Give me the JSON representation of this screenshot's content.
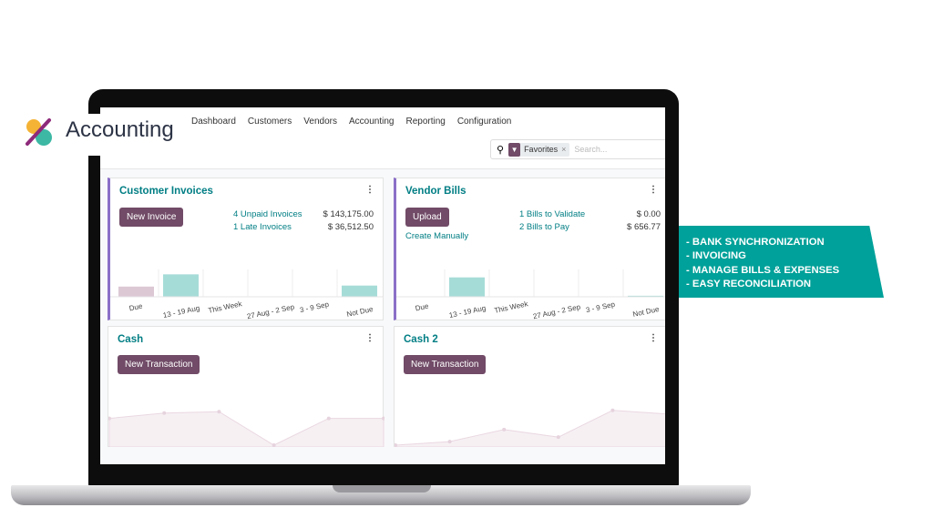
{
  "logo": {
    "title": "Accounting"
  },
  "menu": [
    "Dashboard",
    "Customers",
    "Vendors",
    "Accounting",
    "Reporting",
    "Configuration"
  ],
  "search": {
    "facet": "Favorites",
    "placeholder": "Search..."
  },
  "customer_invoices": {
    "title": "Customer Invoices",
    "button": "New Invoice",
    "links": [
      {
        "label": "4 Unpaid Invoices",
        "amount": "$ 143,175.00"
      },
      {
        "label": "1 Late Invoices",
        "amount": "$ 36,512.50"
      }
    ],
    "graph": {
      "categories": [
        "Due",
        "13 - 19 Aug",
        "This Week",
        "27 Aug - 2 Sep",
        "3 - 9 Sep",
        "Not Due"
      ],
      "values": [
        10,
        22,
        0,
        0,
        0,
        11
      ]
    }
  },
  "vendor_bills": {
    "title": "Vendor Bills",
    "button": "Upload",
    "create": "Create Manually",
    "links": [
      {
        "label": "1 Bills to Validate",
        "amount": "$ 0.00"
      },
      {
        "label": "2 Bills to Pay",
        "amount": "$ 656.77"
      }
    ],
    "graph": {
      "categories": [
        "Due",
        "13 - 19 Aug",
        "This Week",
        "27 Aug - 2 Sep",
        "3 - 9 Sep",
        "Not Due"
      ],
      "values": [
        0,
        19,
        0,
        0,
        0,
        1
      ]
    }
  },
  "cash": {
    "title": "Cash",
    "button": "New Transaction",
    "line": [
      60,
      72,
      75,
      0,
      60,
      60
    ]
  },
  "cash2": {
    "title": "Cash 2",
    "button": "New Transaction",
    "line": [
      0,
      8,
      35,
      18,
      78,
      70
    ]
  },
  "features": [
    "- BANK SYNCHRONIZATION",
    "- INVOICING",
    "- MANAGE BILLS & EXPENSES",
    "- EASY RECONCILIATION"
  ],
  "colors": {
    "primary": "#714b67",
    "link": "#017e84",
    "banner": "#00a19a",
    "bar": "#a6dcd8",
    "bar_past": "#dcc8d5"
  }
}
